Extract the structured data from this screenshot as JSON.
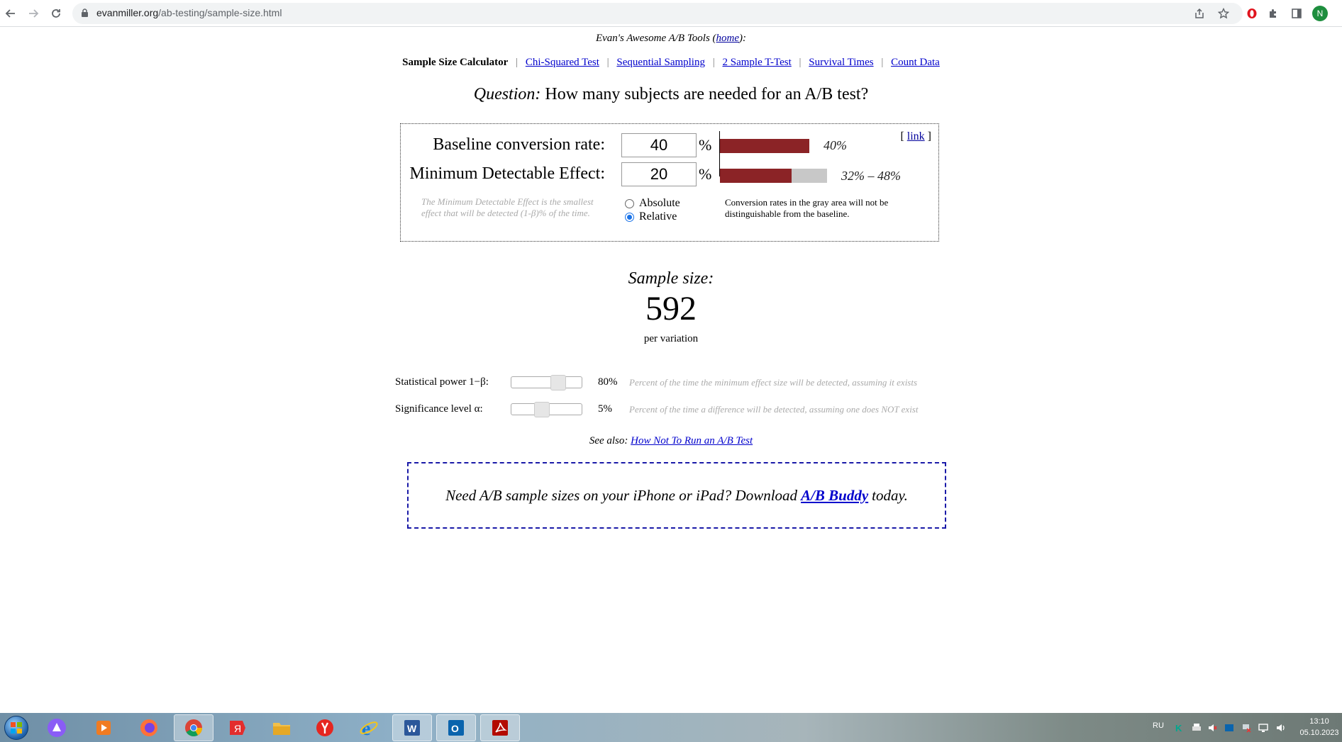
{
  "browser": {
    "url_domain": "evanmiller.org",
    "url_path": "/ab-testing/sample-size.html",
    "profile_initial": "N"
  },
  "page": {
    "tools_header_prefix": "Evan's Awesome A/B Tools (",
    "tools_header_link": "home",
    "tools_header_suffix": "):",
    "nav": {
      "current": "Sample Size Calculator",
      "links": [
        "Chi-Squared Test",
        "Sequential Sampling",
        "2 Sample T-Test",
        "Survival Times",
        "Count Data"
      ],
      "separator": "|"
    },
    "question_prefix": "Question:",
    "question_text": "How many subjects are needed for an A/B test?",
    "calculator": {
      "baseline_label": "Baseline conversion rate:",
      "baseline_value": "40",
      "baseline_unit": "%",
      "baseline_bar_text": "40%",
      "baseline_fraction": 0.4,
      "mde_label": "Minimum Detectable Effect:",
      "mde_value": "20",
      "mde_unit": "%",
      "mde_bar_text": "32% – 48%",
      "mde_range": [
        0.32,
        0.48
      ],
      "link_open": "[",
      "link_label": "link",
      "link_close": "]",
      "mde_note": "The Minimum Detectable Effect is the smallest effect that will be detected (1-β)% of the time.",
      "radio_absolute": "Absolute",
      "radio_relative": "Relative",
      "selected_mode": "Relative",
      "gray_note": "Conversion rates in the gray area will not be distinguishable from the baseline.",
      "colors": {
        "bar": "#8b2326",
        "gray_area": "#c8c8c8"
      }
    },
    "result": {
      "title": "Sample size:",
      "value": "592",
      "unit": "per variation"
    },
    "power": {
      "label": "Statistical power 1−β:",
      "value": "80%",
      "level": 0.8,
      "description": "Percent of the time the minimum effect size will be detected, assuming it exists"
    },
    "significance": {
      "label": "Significance level α:",
      "value": "5%",
      "level": 0.05,
      "description": "Percent of the time a difference will be detected, assuming one does NOT exist"
    },
    "see_also": {
      "prefix": "See also:",
      "link": "How Not To Run an A/B Test"
    },
    "promo": {
      "prefix": "Need A/B sample sizes on your iPhone or iPad? Download",
      "link": "A/B Buddy",
      "suffix": "today."
    }
  },
  "taskbar": {
    "language": "RU",
    "time": "13:10",
    "date": "05.10.2023",
    "apps": [
      "alice-icon",
      "media-player-icon",
      "firefox-icon",
      "chrome-icon",
      "yandex-browser-icon",
      "file-explorer-icon",
      "yandex-icon",
      "internet-explorer-icon",
      "word-icon",
      "outlook-icon",
      "acrobat-icon"
    ]
  }
}
